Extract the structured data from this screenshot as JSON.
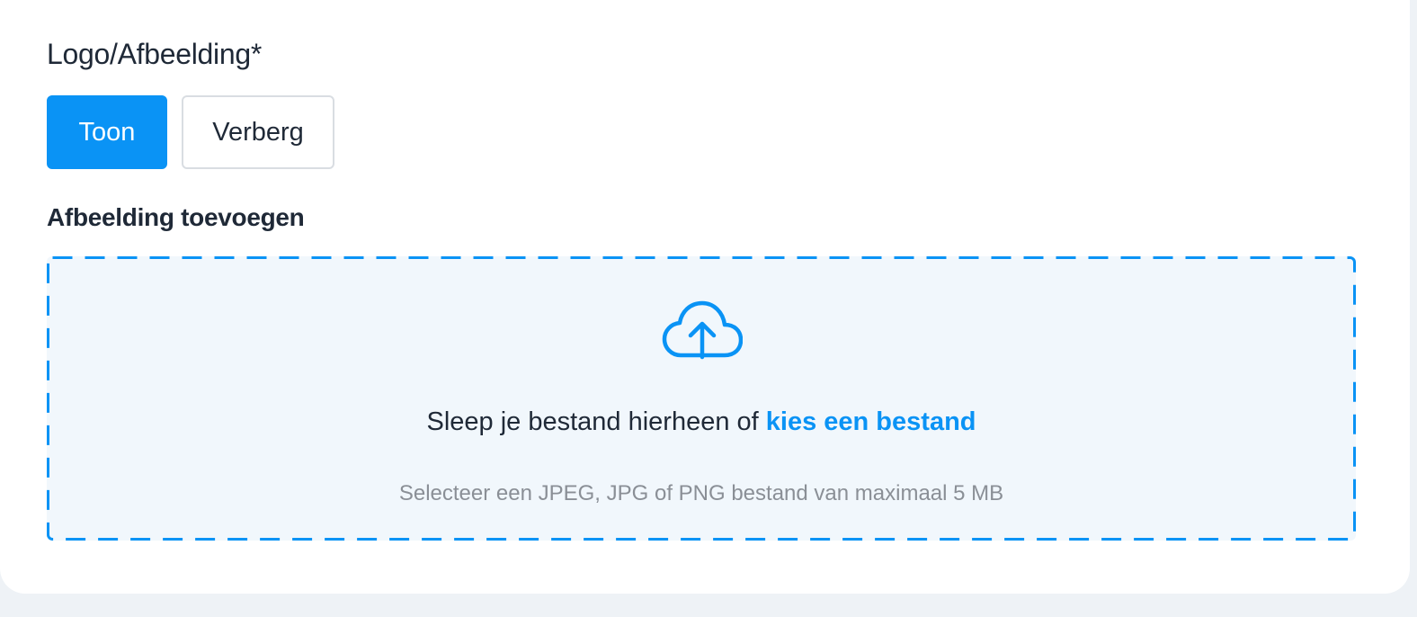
{
  "section": {
    "title": "Logo/Afbeelding*"
  },
  "toggle": {
    "show_label": "Toon",
    "hide_label": "Verberg",
    "selected": "Toon"
  },
  "upload": {
    "title": "Afbeelding toevoegen",
    "drop_text": "Sleep je bestand hierheen of",
    "choose_link": "kies een bestand",
    "hint": "Selecteer een JPEG, JPG of PNG bestand van maximaal 5 MB",
    "icon": "cloud-upload-icon"
  },
  "colors": {
    "accent": "#0a93f5",
    "dropzone_bg": "#f1f7fc",
    "text": "#1f2937",
    "muted": "#8a8f96"
  }
}
